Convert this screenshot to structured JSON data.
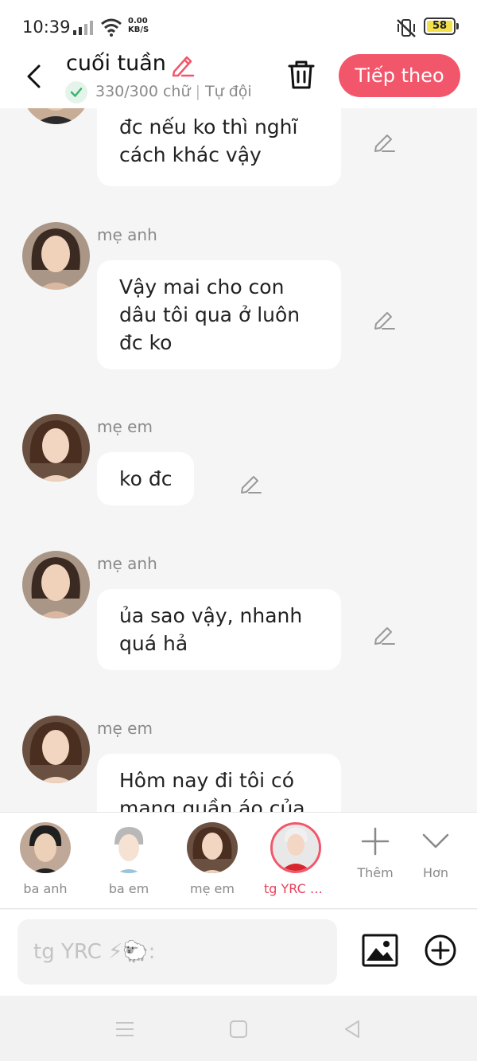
{
  "status_bar": {
    "time": "10:39",
    "net_speed_value": "0.00",
    "net_speed_unit": "KB/S",
    "battery": "58"
  },
  "header": {
    "title": "cuối tuần",
    "word_count": "330/300 chữ",
    "mode": "Tự đội",
    "next_label": "Tiếp theo"
  },
  "messages": [
    {
      "sender": "",
      "text": "đc nếu ko thì nghĩ\ncách khác vậy"
    },
    {
      "sender": "mẹ anh",
      "text": "Vậy mai cho con\ndâu tôi qua ở luôn\nđc ko"
    },
    {
      "sender": "mẹ em",
      "text": "ko đc"
    },
    {
      "sender": "mẹ anh",
      "text": "ủa sao vậy, nhanh\nquá hả"
    },
    {
      "sender": "mẹ em",
      "text": "Hôm nay đi tôi có\nmang quần áo của"
    }
  ],
  "characters": [
    {
      "name": "ba anh"
    },
    {
      "name": "ba em"
    },
    {
      "name": "mẹ em"
    },
    {
      "name": "tg YRC ⚡..."
    }
  ],
  "bar_actions": {
    "more": "Thêm",
    "expand": "Hơn"
  },
  "input": {
    "placeholder": "tg YRC ⚡🐑:"
  },
  "icons": {
    "back": "chevron-left-icon",
    "edit": "pencil-icon",
    "trash": "trash-icon",
    "image": "image-icon",
    "add": "plus-circle-icon"
  },
  "colors": {
    "accent": "#f2566b",
    "active_name": "#e8415a",
    "check": "#3cb46e"
  }
}
